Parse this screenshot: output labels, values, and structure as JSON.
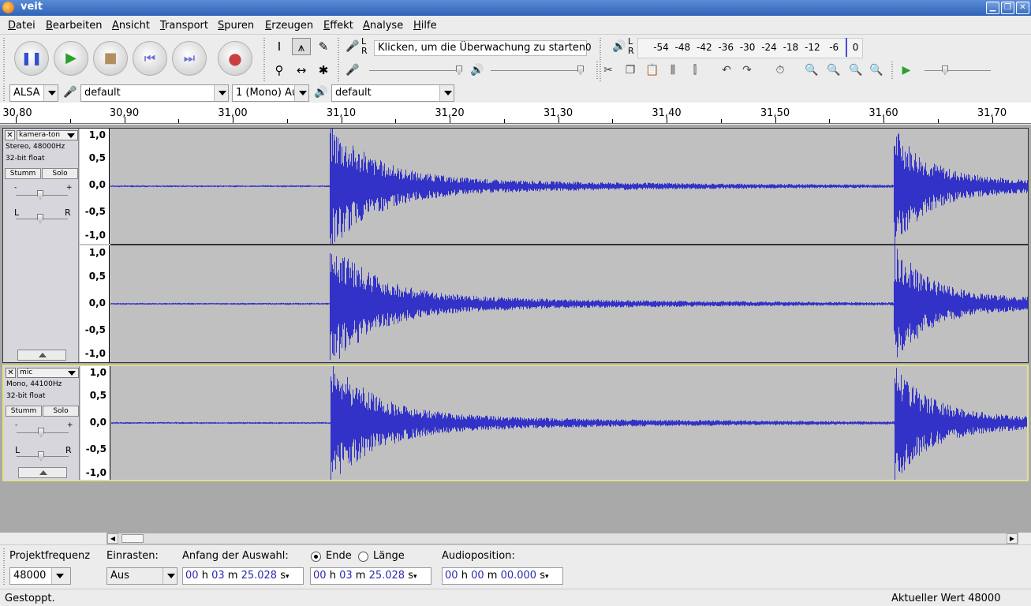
{
  "window": {
    "title": "veit"
  },
  "menu": [
    "Datei",
    "Bearbeiten",
    "Ansicht",
    "Transport",
    "Spuren",
    "Erzeugen",
    "Effekt",
    "Analyse",
    "Hilfe"
  ],
  "meter": {
    "monitor_hint": "Klicken, um die Überwachung zu starten",
    "monitor_zero": "0",
    "lr_label_l": "L",
    "lr_label_r": "R",
    "scale": [
      "-54",
      "-48",
      "-42",
      "-36",
      "-30",
      "-24",
      "-18",
      "-12",
      "-6",
      "0"
    ]
  },
  "device": {
    "host": "ALSA",
    "rec_device": "default",
    "channels": "1 (Mono) Au",
    "play_device": "default"
  },
  "ruler": {
    "labels": [
      "30,80",
      "30,90",
      "31,00",
      "31,10",
      "31,20",
      "31,30",
      "31,40",
      "31,50",
      "31,60",
      "31,70"
    ]
  },
  "tracks": [
    {
      "name": "kamera-ton",
      "info1": "Stereo, 48000Hz",
      "info2": "32-bit float",
      "mute": "Stumm",
      "solo": "Solo",
      "gain_minus": "-",
      "gain_plus": "+",
      "pan_l": "L",
      "pan_r": "R",
      "scale": [
        "1,0",
        "0,5",
        "0,0",
        "-0,5",
        "-1,0"
      ]
    },
    {
      "name": "mic",
      "info1": "Mono, 44100Hz",
      "info2": "32-bit float",
      "mute": "Stumm",
      "solo": "Solo",
      "gain_minus": "-",
      "gain_plus": "+",
      "pan_l": "L",
      "pan_r": "R",
      "scale": [
        "1,0",
        "0,5",
        "0,0",
        "-0,5",
        "-1,0"
      ]
    }
  ],
  "selection": {
    "rate_label": "Projektfrequenz",
    "rate_value": "48000",
    "snap_label": "Einrasten:",
    "snap_value": "Aus",
    "start_label": "Anfang der Auswahl:",
    "end_label": "Ende",
    "length_label": "Länge",
    "audiopos_label": "Audioposition:",
    "start_time": {
      "h": "00",
      "m": "03",
      "s": "25.028"
    },
    "end_time": {
      "h": "00",
      "m": "03",
      "s": "25.028"
    },
    "audio_time": {
      "h": "00",
      "m": "00",
      "s": "00.000"
    },
    "unit_h": "h",
    "unit_m": "m",
    "unit_s": "s"
  },
  "status": {
    "left": "Gestoppt.",
    "right": "Aktueller Wert 48000"
  },
  "colors": {
    "waveform": "#3232c8",
    "selected_track_border": "#e0e090"
  }
}
